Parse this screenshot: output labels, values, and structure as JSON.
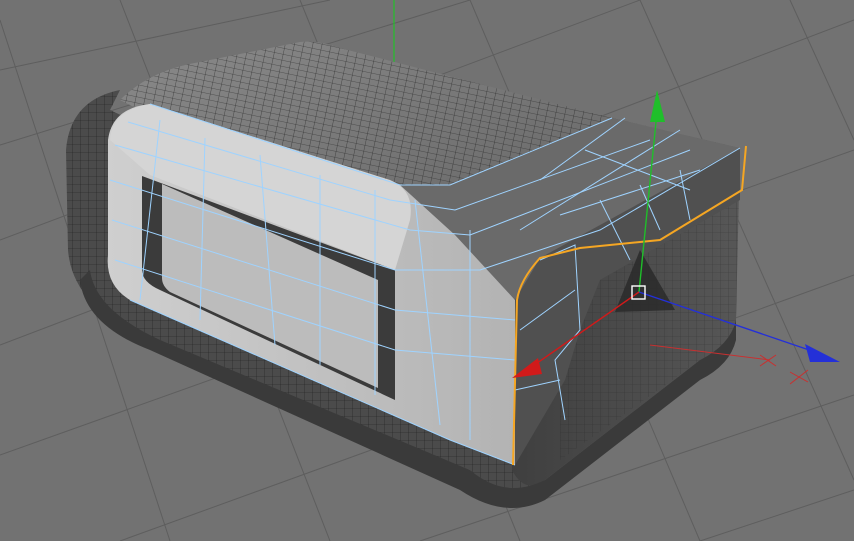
{
  "viewport": {
    "name": "3d-viewport",
    "background": "#727272",
    "grid_color": "#5f5f5f",
    "grid_major_color": "#666666"
  },
  "object": {
    "name": "rounded-box-mesh",
    "shaded_color": "#b9b9b9",
    "dark_face_color": "#4a4a4a",
    "wire_color": "#222222",
    "selected_wire_color": "#9fd3ff",
    "selected_edge_color": "#f5a623"
  },
  "gizmo": {
    "x_axis_color": "#d11a1a",
    "y_axis_color": "#1fbf2a",
    "z_axis_color": "#2430d8",
    "center_handle_color": "#ffffff",
    "plane_handle_color": "#2a2a2a"
  },
  "world_axis": {
    "y_color": "#22c02a",
    "x_color": "#c83030"
  }
}
